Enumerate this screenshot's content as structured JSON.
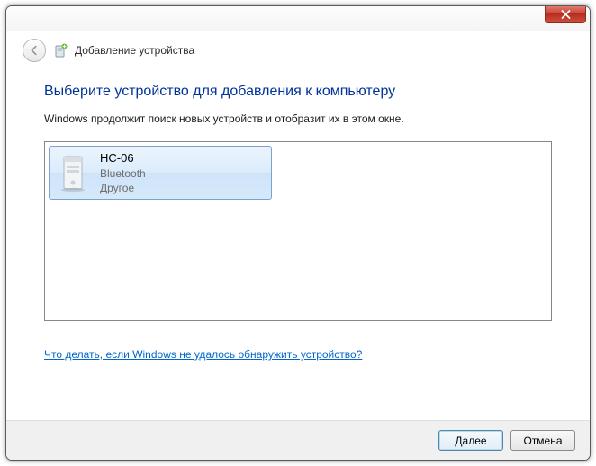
{
  "header": {
    "title": "Добавление устройства"
  },
  "main": {
    "heading": "Выберите устройство для добавления к компьютеру",
    "subtext": "Windows продолжит поиск новых устройств и отобразит их в этом окне."
  },
  "devices": [
    {
      "name": "HC-06",
      "type": "Bluetooth",
      "category": "Другое"
    }
  ],
  "help_link": "Что делать, если Windows не удалось обнаружить устройство?",
  "footer": {
    "next": "Далее",
    "cancel": "Отмена"
  }
}
